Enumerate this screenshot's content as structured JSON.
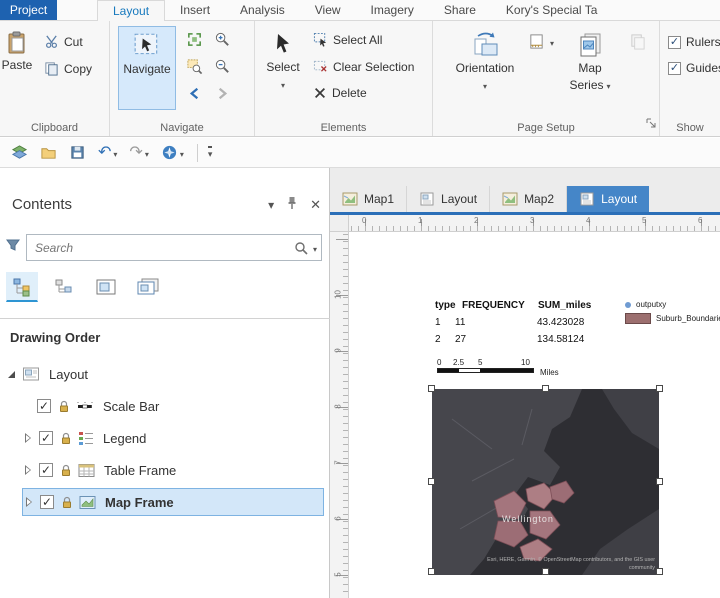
{
  "ribbon": {
    "file_tab": "Project",
    "tabs": [
      "Layout",
      "Insert",
      "Analysis",
      "View",
      "Imagery",
      "Share",
      "Kory's Special Ta"
    ],
    "active_tab": "Layout",
    "clipboard": {
      "label": "Clipboard",
      "paste": "Paste",
      "cut": "Cut",
      "copy": "Copy"
    },
    "navigate_group": {
      "label": "Navigate",
      "navigate": "Navigate"
    },
    "elements_group": {
      "label": "Elements",
      "select": "Select",
      "select_all": "Select All",
      "clear_selection": "Clear Selection",
      "delete": "Delete"
    },
    "page_setup": {
      "label": "Page Setup",
      "orientation": "Orientation",
      "map_series_line1": "Map",
      "map_series_line2": "Series"
    },
    "show_group": {
      "label": "Show",
      "rulers": "Rulers",
      "guides": "Guides"
    }
  },
  "contents": {
    "title": "Contents",
    "search_placeholder": "Search",
    "section_heading": "Drawing Order",
    "root_item": "Layout",
    "items": [
      "Scale Bar",
      "Legend",
      "Table Frame",
      "Map Frame"
    ],
    "selected_item": "Map Frame"
  },
  "view_tabs": {
    "tabs": [
      "Map1",
      "Layout",
      "Map2",
      "Layout"
    ],
    "active_index": 3
  },
  "rulers": {
    "horizontal": [
      "0",
      "1",
      "2",
      "3",
      "4",
      "5",
      "6"
    ],
    "vertical": [
      "10",
      "9",
      "8",
      "7",
      "6",
      "5"
    ]
  },
  "layout_page": {
    "table_frame": {
      "headers": [
        "type",
        "FREQUENCY",
        "SUM_miles"
      ],
      "rows": [
        [
          "1",
          "11",
          "43.423028"
        ],
        [
          "2",
          "27",
          "134.58124"
        ]
      ]
    },
    "legend": {
      "items": [
        {
          "label": "outputxy",
          "symbol": "point",
          "color": "#6f9bd2"
        },
        {
          "label": "Suburb_Boundaries",
          "symbol": "polygon",
          "color": "#9c6f6f"
        }
      ]
    },
    "scale_bar": {
      "labels": [
        "0",
        "2.5",
        "5",
        "10"
      ],
      "unit": "Miles"
    },
    "map_frame": {
      "place_label": "Wellington",
      "attribution_line1": "Esri, HERE, Garmin, © OpenStreetMap contributors, and the GIS user",
      "attribution_line2": "community"
    }
  },
  "colors": {
    "accent_blue": "#2b6fb8",
    "selection_fill": "#d3e7f9",
    "navigate_highlight": "#d6e9fb"
  }
}
